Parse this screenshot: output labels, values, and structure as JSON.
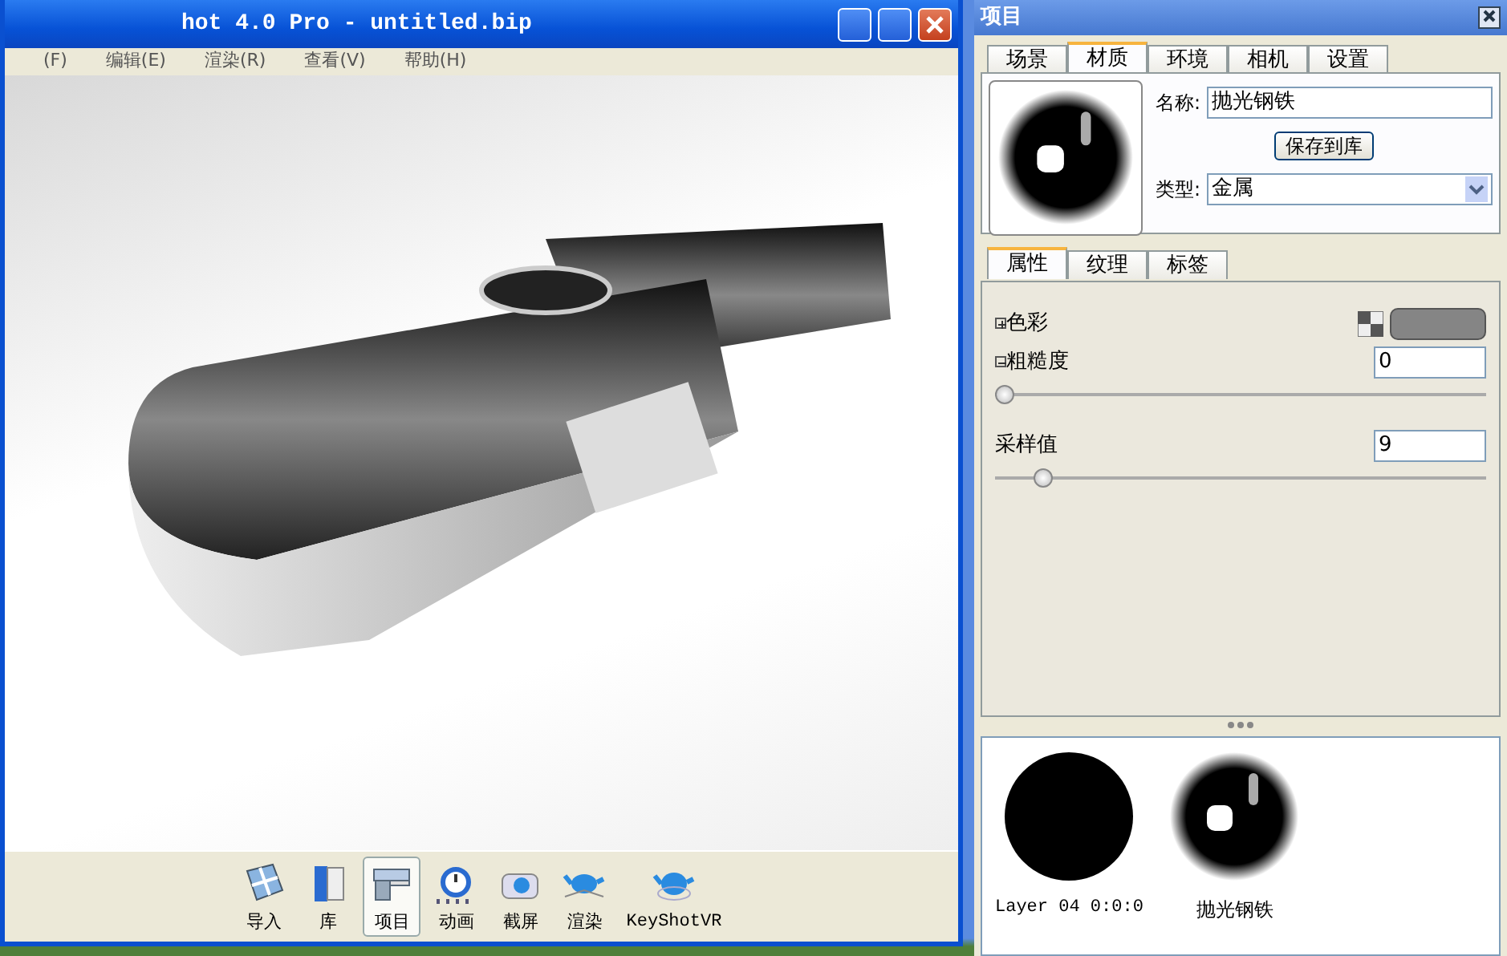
{
  "main_window": {
    "title": "hot 4.0 Pro  - untitled.bip",
    "menu": [
      "(F)",
      "编辑(E)",
      "渲染(R)",
      "查看(V)",
      "帮助(H)"
    ],
    "toolbar": [
      {
        "label": "导入",
        "selected": false
      },
      {
        "label": "库",
        "selected": false
      },
      {
        "label": "项目",
        "selected": true
      },
      {
        "label": "动画",
        "selected": false
      },
      {
        "label": "截屏",
        "selected": false
      },
      {
        "label": "渲染",
        "selected": false
      },
      {
        "label": "KeyShotVR",
        "selected": false
      }
    ]
  },
  "project_panel": {
    "title": "项目",
    "tabs": [
      {
        "label": "场景",
        "selected": false
      },
      {
        "label": "材质",
        "selected": true
      },
      {
        "label": "环境",
        "selected": false
      },
      {
        "label": "相机",
        "selected": false
      },
      {
        "label": "设置",
        "selected": false
      }
    ],
    "material": {
      "name_label": "名称:",
      "name": "抛光钢铁",
      "save_button": "保存到库",
      "type_label": "类型:",
      "type": "金属"
    },
    "sub_tabs": [
      {
        "label": "属性",
        "selected": true
      },
      {
        "label": "纹理",
        "selected": false
      },
      {
        "label": "标签",
        "selected": false
      }
    ],
    "properties": [
      {
        "kind": "color",
        "label": "色彩",
        "expanded": false
      },
      {
        "kind": "slider",
        "label": "粗糙度",
        "expanded": true,
        "value": "0",
        "level": 0.0
      },
      {
        "kind": "slider",
        "label": "采样值",
        "value": "9",
        "level": 0.08
      }
    ],
    "library": [
      {
        "kind": "black",
        "label": "Layer 04 0:0:0"
      },
      {
        "kind": "metal",
        "label": "抛光钢铁"
      }
    ]
  }
}
